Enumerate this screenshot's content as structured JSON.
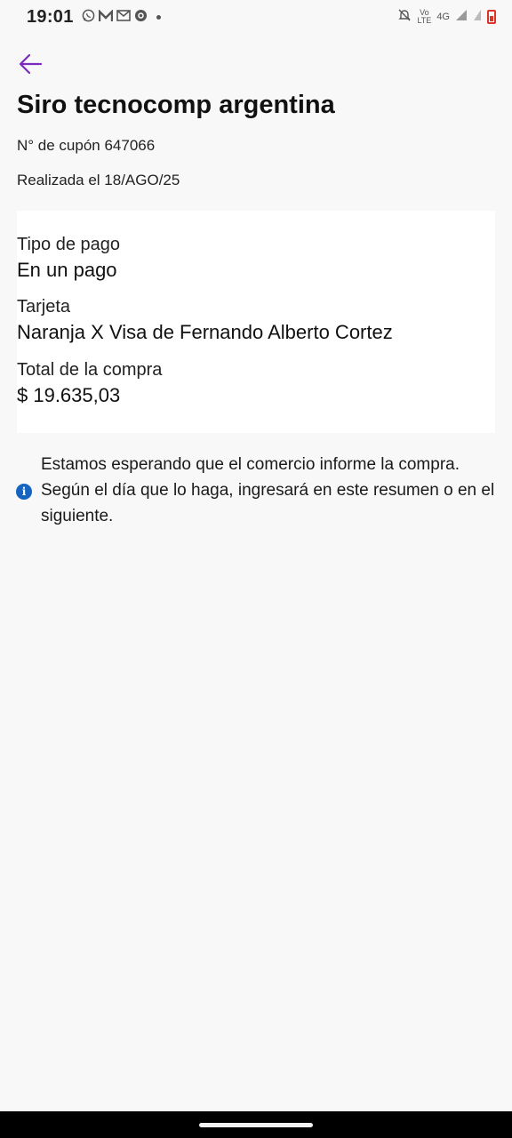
{
  "status_bar": {
    "time": "19:01",
    "apps": [
      "whatsapp-icon",
      "m-app-icon",
      "gmail-icon",
      "record-icon"
    ],
    "vo_lte_top": "Vo",
    "vo_lte_bottom": "LTE",
    "network": "4G",
    "battery_color": "#d9352b"
  },
  "header": {
    "back_icon": "arrow-left-icon",
    "accent_color": "#7b2cbf"
  },
  "purchase": {
    "merchant": "Siro tecnocomp argentina",
    "coupon": "N° de cupón 647066",
    "date": "Realizada el 18/AGO/25"
  },
  "details": {
    "payment_type_label": "Tipo de pago",
    "payment_type_value": "En un pago",
    "card_label": "Tarjeta",
    "card_value": "Naranja X Visa de Fernando Alberto Cortez",
    "total_label": "Total de la compra",
    "total_value": "$ 19.635,03"
  },
  "note": {
    "icon": "info-icon",
    "icon_color": "#1565c0",
    "text": "Estamos esperando que el comercio informe la compra. Según el día que lo haga, ingresará en este resumen o en el siguiente."
  }
}
